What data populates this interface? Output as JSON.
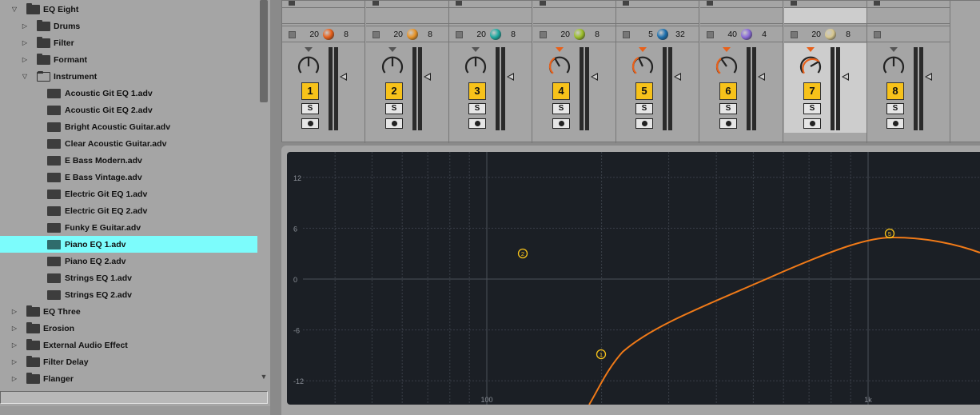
{
  "browser": {
    "items": [
      {
        "label": "EQ Eight",
        "kind": "folder",
        "expanded": true,
        "level": 0
      },
      {
        "label": "Drums",
        "kind": "folder",
        "expanded": false,
        "level": 1
      },
      {
        "label": "Filter",
        "kind": "folder",
        "expanded": false,
        "level": 1
      },
      {
        "label": "Formant",
        "kind": "folder",
        "expanded": false,
        "level": 1
      },
      {
        "label": "Instrument",
        "kind": "folder",
        "expanded": true,
        "level": 1
      },
      {
        "label": "Acoustic Git EQ 1.adv",
        "kind": "file",
        "level": 2
      },
      {
        "label": "Acoustic Git EQ 2.adv",
        "kind": "file",
        "level": 2
      },
      {
        "label": "Bright Acoustic Guitar.adv",
        "kind": "file",
        "level": 2
      },
      {
        "label": "Clear Acoustic Guitar.adv",
        "kind": "file",
        "level": 2
      },
      {
        "label": "E Bass Modern.adv",
        "kind": "file",
        "level": 2
      },
      {
        "label": "E Bass Vintage.adv",
        "kind": "file",
        "level": 2
      },
      {
        "label": "Electric Git EQ 1.adv",
        "kind": "file",
        "level": 2
      },
      {
        "label": "Electric Git EQ 2.adv",
        "kind": "file",
        "level": 2
      },
      {
        "label": "Funky E Guitar.adv",
        "kind": "file",
        "level": 2
      },
      {
        "label": "Piano EQ 1.adv",
        "kind": "file",
        "level": 2,
        "selected": true
      },
      {
        "label": "Piano EQ 2.adv",
        "kind": "file",
        "level": 2
      },
      {
        "label": "Strings EQ 1.adv",
        "kind": "file",
        "level": 2
      },
      {
        "label": "Strings EQ 2.adv",
        "kind": "file",
        "level": 2
      },
      {
        "label": "EQ Three",
        "kind": "folder",
        "expanded": false,
        "level": 0
      },
      {
        "label": "Erosion",
        "kind": "folder",
        "expanded": false,
        "level": 0
      },
      {
        "label": "External Audio Effect",
        "kind": "folder",
        "expanded": false,
        "level": 0
      },
      {
        "label": "Filter Delay",
        "kind": "folder",
        "expanded": false,
        "level": 0
      },
      {
        "label": "Flanger",
        "kind": "folder",
        "expanded": false,
        "level": 0
      }
    ],
    "search_value": ""
  },
  "mixer": {
    "strips": [
      {
        "num": "1",
        "val_a": "20",
        "val_b": "8",
        "ball": "#e8601a",
        "solo": "S",
        "mark": "#555555",
        "knob": 0
      },
      {
        "num": "2",
        "val_a": "20",
        "val_b": "8",
        "ball": "#e89428",
        "solo": "S",
        "mark": "#555555",
        "knob": 0
      },
      {
        "num": "3",
        "val_a": "20",
        "val_b": "8",
        "ball": "#1fa9a0",
        "solo": "S",
        "mark": "#555555",
        "knob": 0
      },
      {
        "num": "4",
        "val_a": "20",
        "val_b": "8",
        "ball": "#9cbf2a",
        "solo": "S",
        "mark": "#e8601a",
        "knob": -30
      },
      {
        "num": "5",
        "val_a": "5",
        "val_b": "32",
        "ball": "#1b6fae",
        "solo": "S",
        "mark": "#e8601a",
        "knob": -25
      },
      {
        "num": "6",
        "val_a": "40",
        "val_b": "4",
        "ball": "#8a6ad8",
        "solo": "S",
        "mark": "#e8601a",
        "knob": -35
      },
      {
        "num": "7",
        "val_a": "20",
        "val_b": "8",
        "ball": "#d8c890",
        "solo": "S",
        "mark": "#e8601a",
        "knob": 60,
        "selected": true
      },
      {
        "num": "8",
        "val_a": "",
        "val_b": "",
        "ball": "",
        "solo": "S",
        "mark": "#555555",
        "knob": 0
      }
    ]
  },
  "eq": {
    "y_labels": [
      "12",
      "6",
      "0",
      "-6",
      "-12"
    ],
    "x_labels": [
      "100",
      "1k"
    ],
    "handles": [
      "1",
      "2",
      "5"
    ],
    "curve_color": "#f07a18",
    "handle_color": "#f7c21a"
  }
}
